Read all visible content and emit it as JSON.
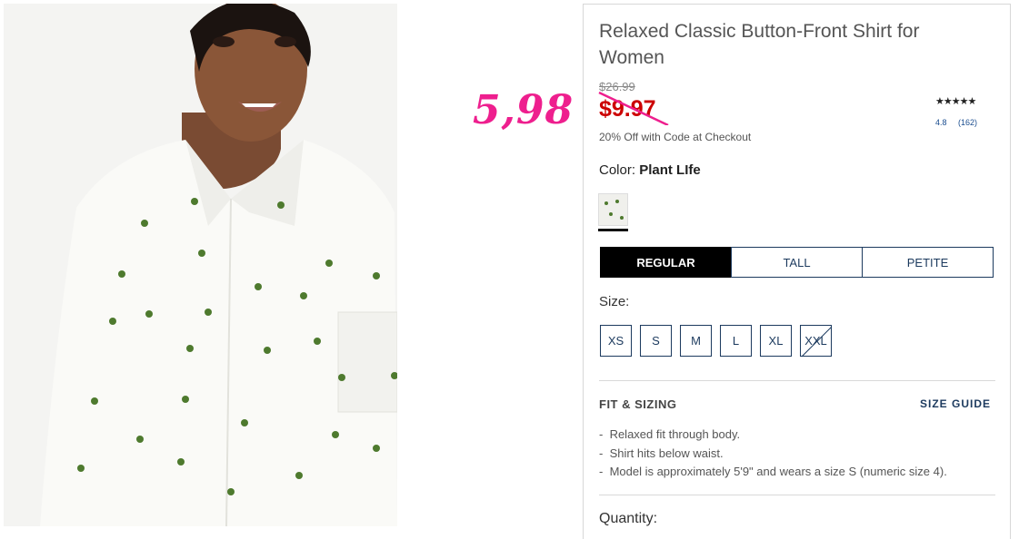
{
  "annotation": {
    "price": "5,98"
  },
  "product": {
    "title": "Relaxed Classic Button-Front Shirt for Women",
    "original_price": "$26.99",
    "sale_price": "$9.97",
    "promo": "20% Off with Code at Checkout",
    "rating": {
      "stars": "★★★★★",
      "score": "4.8",
      "count": "(162)"
    },
    "color_label": "Color:",
    "color_value": "Plant LIfe"
  },
  "fit_tabs": [
    {
      "label": "REGULAR",
      "active": true
    },
    {
      "label": "TALL",
      "active": false
    },
    {
      "label": "PETITE",
      "active": false
    }
  ],
  "size_label": "Size:",
  "sizes": [
    {
      "label": "XS",
      "available": true
    },
    {
      "label": "S",
      "available": true
    },
    {
      "label": "M",
      "available": true
    },
    {
      "label": "L",
      "available": true
    },
    {
      "label": "XL",
      "available": true
    },
    {
      "label": "XXL",
      "available": false
    }
  ],
  "fit_sizing": {
    "title": "FIT & SIZING",
    "guide_link": "SIZE GUIDE",
    "bullets": [
      "Relaxed fit through body.",
      "Shirt hits below waist.",
      "Model is approximately 5'9\" and wears a size S (numeric size 4)."
    ]
  },
  "quantity_label": "Quantity:",
  "colors": {
    "accent": "#cc0000",
    "annotation": "#ee1f8e",
    "navy": "#1c3a5e"
  }
}
